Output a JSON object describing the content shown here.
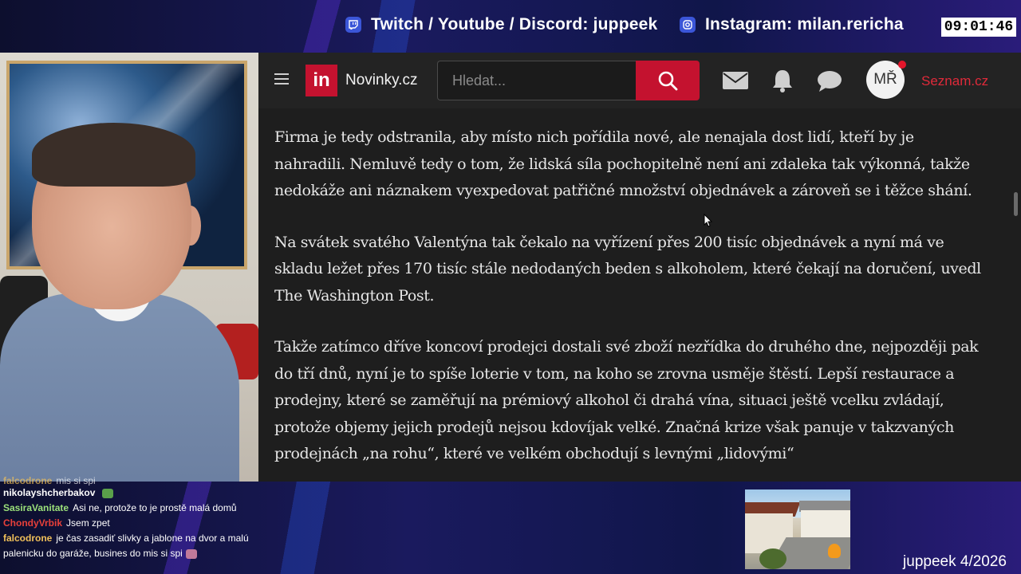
{
  "overlay": {
    "socials": [
      {
        "icon": "twitch-icon",
        "text": "Twitch / Youtube / Discord: juppeek"
      },
      {
        "icon": "instagram-icon",
        "text": "Instagram: milan.rericha"
      }
    ],
    "clock": "09:01:46",
    "watermark": "juppeek 4/2026",
    "accent": "#3b2fa8"
  },
  "browser": {
    "logo_text": "in",
    "brand": "Novinky.cz",
    "search_placeholder": "Hledat...",
    "avatar_initials": "MŘ",
    "seznam_link": "Seznam.cz",
    "brand_color": "#c4122f",
    "article": {
      "paragraphs": [
        "Firma je tedy odstranila, aby místo nich pořídila nové, ale nenajala dost lidí, kteří by je nahradili. Nemluvě tedy o tom, že lidská síla pochopitelně není ani zdaleka tak výkonná, takže nedokáže ani náznakem vyexpedovat patřičné množství objednávek a zároveň se i těžce shání.",
        "Na svátek svatého Valentýna tak čekalo na vyřízení přes 200 tisíc objednávek a nyní má ve skladu ležet přes 170 tisíc stále nedodaných beden s alkoholem, které čekají na doručení, uvedl The Washington Post.",
        "Takže zatímco dříve koncoví prodejci dostali své zboží nezřídka do druhého dne, nejpozději pak do tří dnů, nyní je to spíše loterie v tom, na koho se zrovna usměje štěstí. Lepší restaurace a prodejny, které se zaměřují na prémiový alkohol či drahá vína, situaci ještě vcelku zvládají, protože objemy jejich prodejů nejsou kdovíjak velké. Značná krize však panuje v takzvaných prodejnách „na rohu“, které ve velkém obchodují s levnými „lidovými“"
      ]
    }
  },
  "chat": {
    "messages": [
      {
        "user": "falcodrone",
        "color": "#f0c05a",
        "text": "mis si spi"
      },
      {
        "user": "nikolayshcherbakov",
        "color": "#ffffff",
        "text": ""
      },
      {
        "user": "SasiraVanitate",
        "color": "#9be07a",
        "text": "Asi ne, protože to je prostě malá domů"
      },
      {
        "user": "ChondyVrbik",
        "color": "#e8403a",
        "text": "Jsem zpet"
      },
      {
        "user": "falcodrone",
        "color": "#f0c05a",
        "text": "je čas zasadiť slivky a jablone na dvor a malú"
      },
      {
        "user": "",
        "color": "#ffffff",
        "text": "palenicku do garáže, busines do mis si spi"
      }
    ]
  }
}
